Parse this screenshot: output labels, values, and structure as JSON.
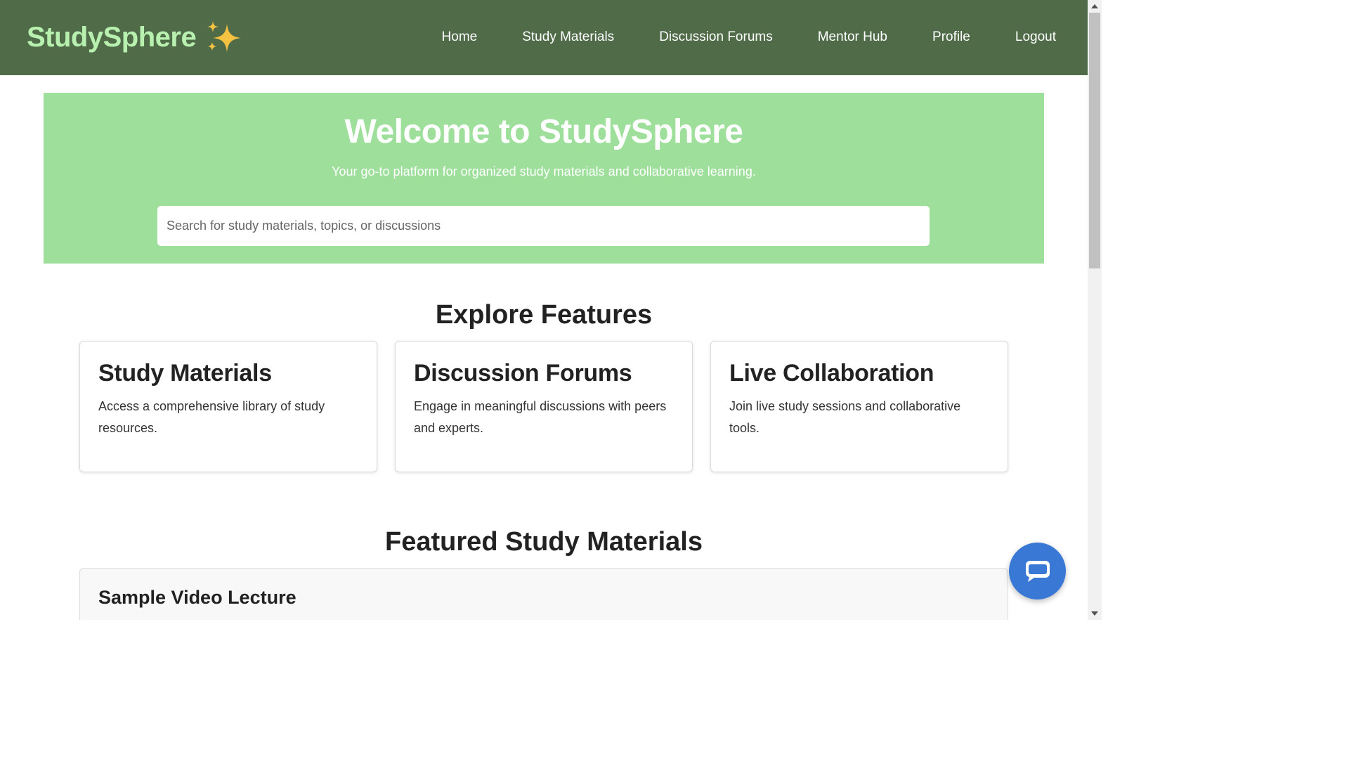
{
  "header": {
    "brand": "StudySphere",
    "brand_icon": "sparkles-icon",
    "nav": [
      {
        "label": "Home"
      },
      {
        "label": "Study Materials"
      },
      {
        "label": "Discussion Forums"
      },
      {
        "label": "Mentor Hub"
      },
      {
        "label": "Profile"
      },
      {
        "label": "Logout"
      }
    ]
  },
  "hero": {
    "title": "Welcome to StudySphere",
    "subtitle": "Your go-to platform for organized study materials and collaborative learning.",
    "search_placeholder": "Search for study materials, topics, or discussions",
    "search_value": ""
  },
  "features": {
    "title": "Explore Features",
    "cards": [
      {
        "title": "Study Materials",
        "description": "Access a comprehensive library of study resources."
      },
      {
        "title": "Discussion Forums",
        "description": "Engage in meaningful discussions with peers and experts."
      },
      {
        "title": "Live Collaboration",
        "description": "Join live study sessions and collaborative tools."
      }
    ]
  },
  "featured_materials": {
    "title": "Featured Study Materials",
    "items": [
      {
        "title": "Sample Video Lecture"
      }
    ]
  },
  "chat": {
    "icon": "chat-bubble-icon"
  },
  "colors": {
    "header_bg": "#4f6b48",
    "brand_text": "#b8f0b0",
    "hero_bg": "#9ddf9b",
    "chat_button": "#3a78d6",
    "sparkle": "#f5c242"
  }
}
